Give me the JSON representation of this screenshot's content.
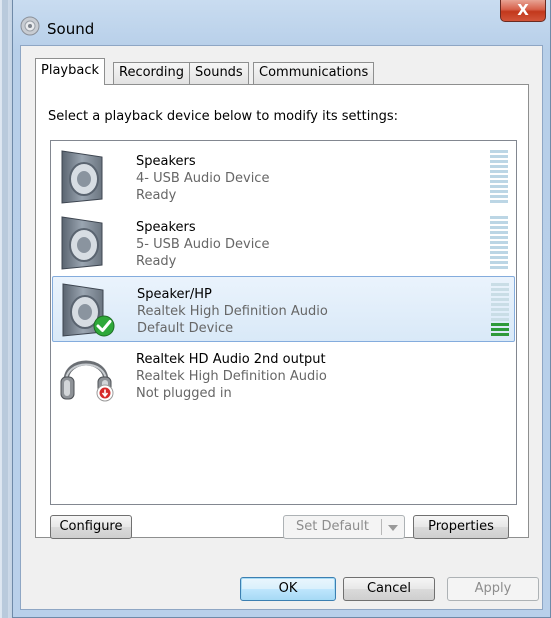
{
  "window": {
    "title": "Sound",
    "close_glyph": "X"
  },
  "tabs": [
    {
      "label": "Playback",
      "active": true
    },
    {
      "label": "Recording",
      "active": false
    },
    {
      "label": "Sounds",
      "active": false
    },
    {
      "label": "Communications",
      "active": false
    }
  ],
  "instruction": "Select a playback device below to modify its settings:",
  "devices": [
    {
      "name": "Speakers",
      "description": "4- USB Audio Device",
      "status": "Ready",
      "icon": "speaker-icon",
      "selected": false,
      "default": false,
      "meter_level": 0
    },
    {
      "name": "Speakers",
      "description": "5- USB Audio Device",
      "status": "Ready",
      "icon": "speaker-icon",
      "selected": false,
      "default": false,
      "meter_level": 0
    },
    {
      "name": "Speaker/HP",
      "description": "Realtek High Definition Audio",
      "status": "Default Device",
      "icon": "speaker-icon",
      "selected": true,
      "default": true,
      "meter_level": 0.3
    },
    {
      "name": "Realtek HD Audio 2nd output",
      "description": "Realtek High Definition Audio",
      "status": "Not plugged in",
      "icon": "headphones-icon",
      "selected": false,
      "default": false,
      "unplugged": true
    }
  ],
  "buttons": {
    "configure": "Configure",
    "set_default": "Set Default",
    "properties": "Properties",
    "ok": "OK",
    "cancel": "Cancel",
    "apply": "Apply"
  },
  "colors": {
    "default_check": "#2fa83a",
    "unplugged_badge": "#d62a2a",
    "selection": "#d9e9f8"
  }
}
